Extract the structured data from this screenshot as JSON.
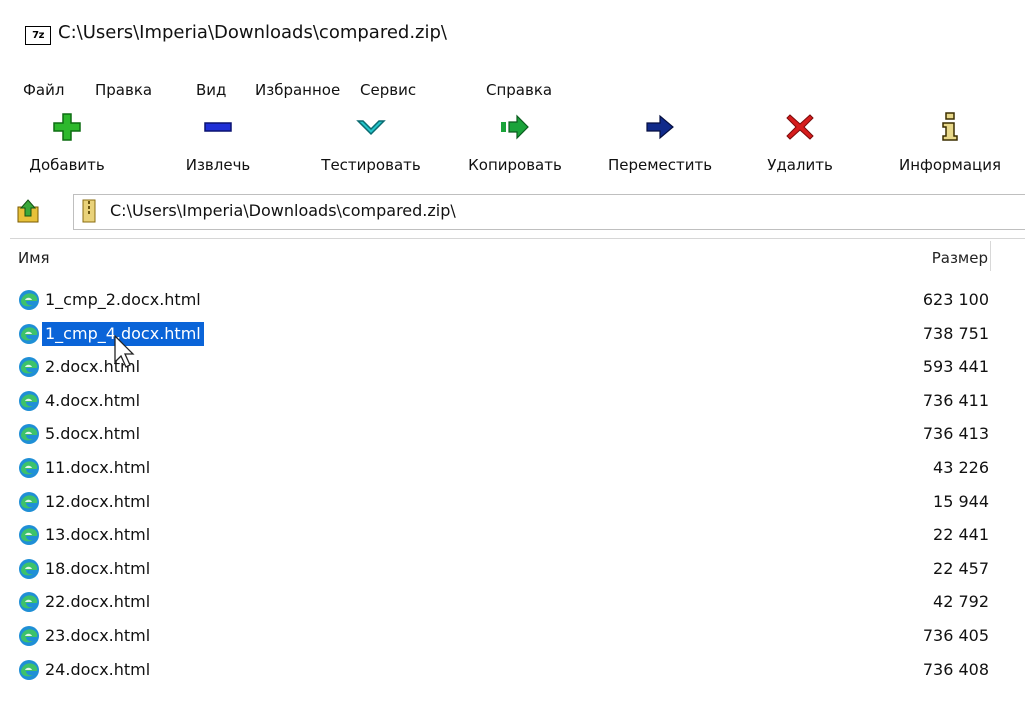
{
  "window": {
    "title": "C:\\Users\\Imperia\\Downloads\\compared.zip\\",
    "app_icon_label": "7z"
  },
  "menu": {
    "items": [
      "Файл",
      "Правка",
      "Вид",
      "Избранное",
      "Сервис",
      "Справка"
    ]
  },
  "toolbar": {
    "buttons": [
      {
        "label": "Добавить",
        "icon": "add-icon",
        "color": "#2db82d"
      },
      {
        "label": "Извлечь",
        "icon": "extract-icon",
        "color": "#1f2fd6"
      },
      {
        "label": "Тестировать",
        "icon": "test-icon",
        "color": "#24c4c9"
      },
      {
        "label": "Копировать",
        "icon": "copy-icon",
        "color": "#1aa33a"
      },
      {
        "label": "Переместить",
        "icon": "move-icon",
        "color": "#102a8a"
      },
      {
        "label": "Удалить",
        "icon": "delete-icon",
        "color": "#d61c1c"
      },
      {
        "label": "Информация",
        "icon": "info-icon",
        "color": "#4a3a00"
      }
    ]
  },
  "address": {
    "path": "C:\\Users\\Imperia\\Downloads\\compared.zip\\"
  },
  "list": {
    "columns": {
      "name": "Имя",
      "size": "Размер"
    },
    "selected_index": 1,
    "files": [
      {
        "name": "1_cmp_2.docx.html",
        "size": "623 100"
      },
      {
        "name": "1_cmp_4.docx.html",
        "size": "738 751"
      },
      {
        "name": "2.docx.html",
        "size": "593 441"
      },
      {
        "name": "4.docx.html",
        "size": "736 411"
      },
      {
        "name": "5.docx.html",
        "size": "736 413"
      },
      {
        "name": "11.docx.html",
        "size": "43 226"
      },
      {
        "name": "12.docx.html",
        "size": "15 944"
      },
      {
        "name": "13.docx.html",
        "size": "22 441"
      },
      {
        "name": "18.docx.html",
        "size": "22 457"
      },
      {
        "name": "22.docx.html",
        "size": "42 792"
      },
      {
        "name": "23.docx.html",
        "size": "736 405"
      },
      {
        "name": "24.docx.html",
        "size": "736 408"
      }
    ]
  }
}
